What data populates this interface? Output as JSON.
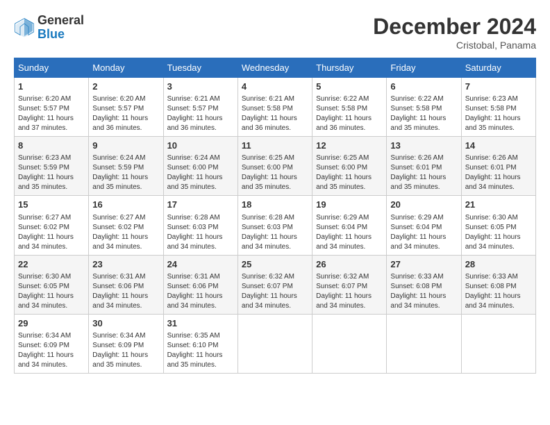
{
  "header": {
    "logo_line1": "General",
    "logo_line2": "Blue",
    "title": "December 2024",
    "subtitle": "Cristobal, Panama"
  },
  "columns": [
    "Sunday",
    "Monday",
    "Tuesday",
    "Wednesday",
    "Thursday",
    "Friday",
    "Saturday"
  ],
  "weeks": [
    [
      {
        "day": "1",
        "lines": [
          "Sunrise: 6:20 AM",
          "Sunset: 5:57 PM",
          "Daylight: 11 hours",
          "and 37 minutes."
        ]
      },
      {
        "day": "2",
        "lines": [
          "Sunrise: 6:20 AM",
          "Sunset: 5:57 PM",
          "Daylight: 11 hours",
          "and 36 minutes."
        ]
      },
      {
        "day": "3",
        "lines": [
          "Sunrise: 6:21 AM",
          "Sunset: 5:57 PM",
          "Daylight: 11 hours",
          "and 36 minutes."
        ]
      },
      {
        "day": "4",
        "lines": [
          "Sunrise: 6:21 AM",
          "Sunset: 5:58 PM",
          "Daylight: 11 hours",
          "and 36 minutes."
        ]
      },
      {
        "day": "5",
        "lines": [
          "Sunrise: 6:22 AM",
          "Sunset: 5:58 PM",
          "Daylight: 11 hours",
          "and 36 minutes."
        ]
      },
      {
        "day": "6",
        "lines": [
          "Sunrise: 6:22 AM",
          "Sunset: 5:58 PM",
          "Daylight: 11 hours",
          "and 35 minutes."
        ]
      },
      {
        "day": "7",
        "lines": [
          "Sunrise: 6:23 AM",
          "Sunset: 5:58 PM",
          "Daylight: 11 hours",
          "and 35 minutes."
        ]
      }
    ],
    [
      {
        "day": "8",
        "lines": [
          "Sunrise: 6:23 AM",
          "Sunset: 5:59 PM",
          "Daylight: 11 hours",
          "and 35 minutes."
        ]
      },
      {
        "day": "9",
        "lines": [
          "Sunrise: 6:24 AM",
          "Sunset: 5:59 PM",
          "Daylight: 11 hours",
          "and 35 minutes."
        ]
      },
      {
        "day": "10",
        "lines": [
          "Sunrise: 6:24 AM",
          "Sunset: 6:00 PM",
          "Daylight: 11 hours",
          "and 35 minutes."
        ]
      },
      {
        "day": "11",
        "lines": [
          "Sunrise: 6:25 AM",
          "Sunset: 6:00 PM",
          "Daylight: 11 hours",
          "and 35 minutes."
        ]
      },
      {
        "day": "12",
        "lines": [
          "Sunrise: 6:25 AM",
          "Sunset: 6:00 PM",
          "Daylight: 11 hours",
          "and 35 minutes."
        ]
      },
      {
        "day": "13",
        "lines": [
          "Sunrise: 6:26 AM",
          "Sunset: 6:01 PM",
          "Daylight: 11 hours",
          "and 35 minutes."
        ]
      },
      {
        "day": "14",
        "lines": [
          "Sunrise: 6:26 AM",
          "Sunset: 6:01 PM",
          "Daylight: 11 hours",
          "and 34 minutes."
        ]
      }
    ],
    [
      {
        "day": "15",
        "lines": [
          "Sunrise: 6:27 AM",
          "Sunset: 6:02 PM",
          "Daylight: 11 hours",
          "and 34 minutes."
        ]
      },
      {
        "day": "16",
        "lines": [
          "Sunrise: 6:27 AM",
          "Sunset: 6:02 PM",
          "Daylight: 11 hours",
          "and 34 minutes."
        ]
      },
      {
        "day": "17",
        "lines": [
          "Sunrise: 6:28 AM",
          "Sunset: 6:03 PM",
          "Daylight: 11 hours",
          "and 34 minutes."
        ]
      },
      {
        "day": "18",
        "lines": [
          "Sunrise: 6:28 AM",
          "Sunset: 6:03 PM",
          "Daylight: 11 hours",
          "and 34 minutes."
        ]
      },
      {
        "day": "19",
        "lines": [
          "Sunrise: 6:29 AM",
          "Sunset: 6:04 PM",
          "Daylight: 11 hours",
          "and 34 minutes."
        ]
      },
      {
        "day": "20",
        "lines": [
          "Sunrise: 6:29 AM",
          "Sunset: 6:04 PM",
          "Daylight: 11 hours",
          "and 34 minutes."
        ]
      },
      {
        "day": "21",
        "lines": [
          "Sunrise: 6:30 AM",
          "Sunset: 6:05 PM",
          "Daylight: 11 hours",
          "and 34 minutes."
        ]
      }
    ],
    [
      {
        "day": "22",
        "lines": [
          "Sunrise: 6:30 AM",
          "Sunset: 6:05 PM",
          "Daylight: 11 hours",
          "and 34 minutes."
        ]
      },
      {
        "day": "23",
        "lines": [
          "Sunrise: 6:31 AM",
          "Sunset: 6:06 PM",
          "Daylight: 11 hours",
          "and 34 minutes."
        ]
      },
      {
        "day": "24",
        "lines": [
          "Sunrise: 6:31 AM",
          "Sunset: 6:06 PM",
          "Daylight: 11 hours",
          "and 34 minutes."
        ]
      },
      {
        "day": "25",
        "lines": [
          "Sunrise: 6:32 AM",
          "Sunset: 6:07 PM",
          "Daylight: 11 hours",
          "and 34 minutes."
        ]
      },
      {
        "day": "26",
        "lines": [
          "Sunrise: 6:32 AM",
          "Sunset: 6:07 PM",
          "Daylight: 11 hours",
          "and 34 minutes."
        ]
      },
      {
        "day": "27",
        "lines": [
          "Sunrise: 6:33 AM",
          "Sunset: 6:08 PM",
          "Daylight: 11 hours",
          "and 34 minutes."
        ]
      },
      {
        "day": "28",
        "lines": [
          "Sunrise: 6:33 AM",
          "Sunset: 6:08 PM",
          "Daylight: 11 hours",
          "and 34 minutes."
        ]
      }
    ],
    [
      {
        "day": "29",
        "lines": [
          "Sunrise: 6:34 AM",
          "Sunset: 6:09 PM",
          "Daylight: 11 hours",
          "and 34 minutes."
        ]
      },
      {
        "day": "30",
        "lines": [
          "Sunrise: 6:34 AM",
          "Sunset: 6:09 PM",
          "Daylight: 11 hours",
          "and 35 minutes."
        ]
      },
      {
        "day": "31",
        "lines": [
          "Sunrise: 6:35 AM",
          "Sunset: 6:10 PM",
          "Daylight: 11 hours",
          "and 35 minutes."
        ]
      },
      null,
      null,
      null,
      null
    ]
  ]
}
